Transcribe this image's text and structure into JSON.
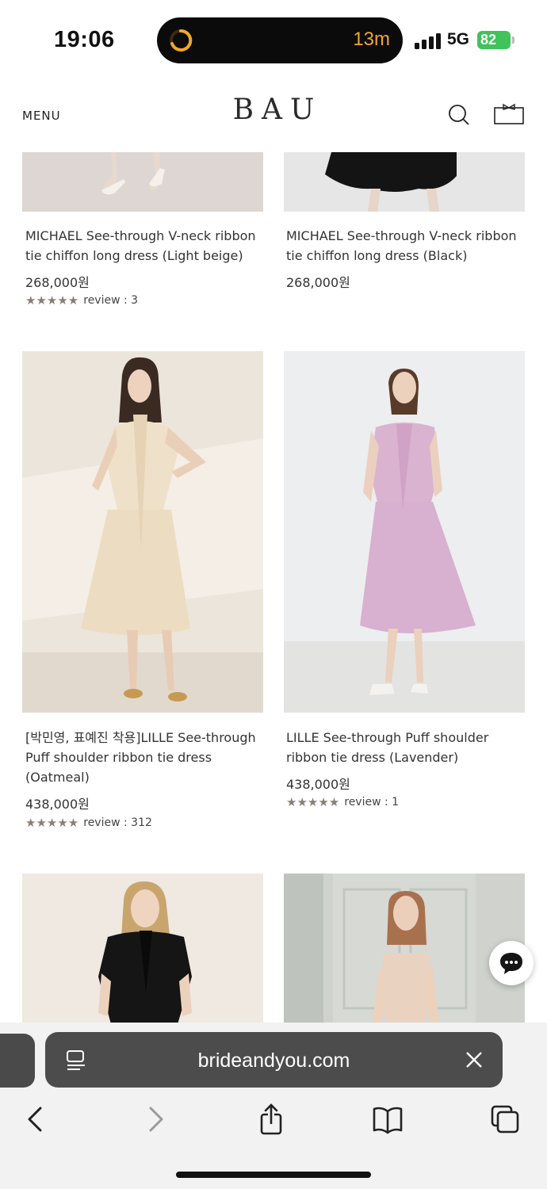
{
  "status": {
    "time": "19:06",
    "activity_timer": "13m",
    "network": "5G",
    "battery": "82"
  },
  "header": {
    "menu_label": "MENU",
    "logo": "BAU"
  },
  "products": [
    {
      "name": "MICHAEL See-through V-neck ribbon tie chiffon long dress (Light beige)",
      "price": "268,000원",
      "stars": "★★★★★",
      "review": "review : 3"
    },
    {
      "name": "MICHAEL See-through V-neck ribbon tie chiffon long dress (Black)",
      "price": "268,000원"
    },
    {
      "name": "[박민영, 표예진 착용]LILLE See-through Puff shoulder ribbon tie dress (Oatmeal)",
      "price": "438,000원",
      "stars": "★★★★★",
      "review": "review : 312"
    },
    {
      "name": "LILLE See-through Puff shoulder ribbon tie dress (Lavender)",
      "price": "438,000원",
      "stars": "★★★★★",
      "review": "review : 1"
    }
  ],
  "browser": {
    "url": "brideandyou.com"
  },
  "icons": {
    "menu": "menu-label",
    "search": "search-icon",
    "bag": "shopping-bag-icon",
    "chat": "chat-bubble-icon",
    "reader": "reader-mode-icon",
    "clear": "close-icon",
    "back": "chevron-left-icon",
    "forward": "chevron-right-icon",
    "share": "share-icon",
    "bookmarks": "book-icon",
    "tabs": "tabs-icon"
  },
  "colors": {
    "accent_timer": "#f2a72c",
    "battery": "#3fc35a",
    "stars": "#8a7e75"
  }
}
